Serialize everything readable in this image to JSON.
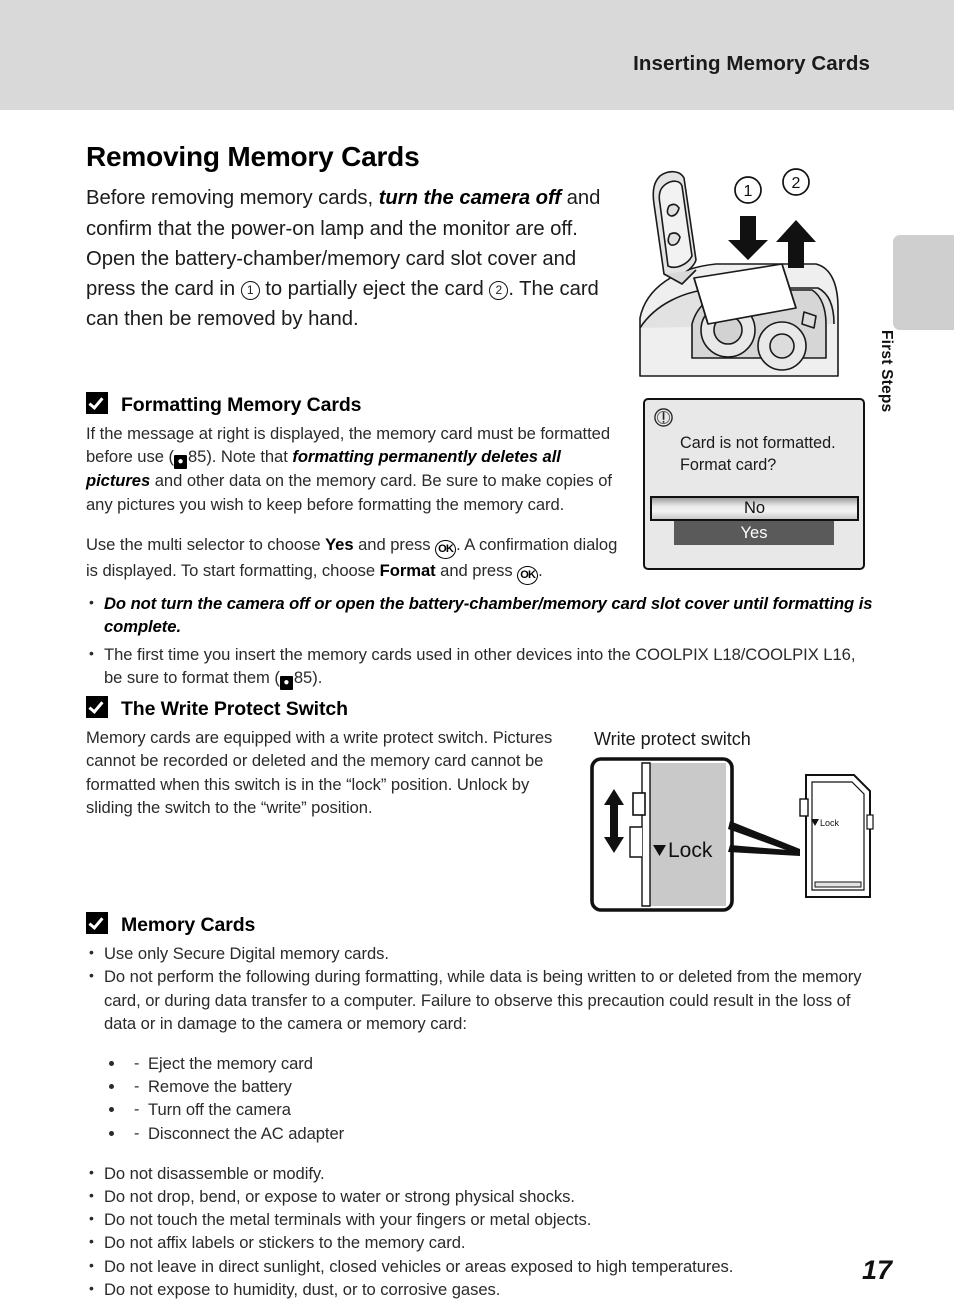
{
  "header": {
    "running_title": "Inserting Memory Cards"
  },
  "side_tab": {
    "label": "First Steps"
  },
  "page": {
    "title": "Removing Memory Cards",
    "number": "17"
  },
  "intro": {
    "part1": "Before removing memory cards, ",
    "bold1": "turn the camera off",
    "part2": " and confirm that the power-on lamp and the monitor are off. Open the battery-chamber/memory card slot cover and press the card in ",
    "circle1": "1",
    "part3": " to partially eject the card ",
    "circle2": "2",
    "part4": ". The card can then be removed by hand."
  },
  "camera_illustration": {
    "name": "camera-card-slot-illustration",
    "callout_1": "1",
    "callout_2": "2"
  },
  "formatting": {
    "heading": "Formatting Memory Cards",
    "p1_a": "If the message at right is displayed, the memory card must be formatted before use (",
    "p1_ref": "85",
    "p1_b": "). Note that ",
    "p1_bi": "formatting permanently deletes all pictures",
    "p1_c": " and other data on the memory card. Be sure to make copies of any pictures you wish to keep before formatting the memory card.",
    "p2_a": "Use the multi selector to choose ",
    "p2_yes": "Yes",
    "p2_b": " and press ",
    "p2_ok1": "OK",
    "p2_c": ". A confirmation dialog is displayed. To start formatting, choose ",
    "p2_format": "Format",
    "p2_d": " and press ",
    "p2_ok2": "OK",
    "p2_e": ".",
    "bullets": [
      {
        "style": "bold-italic",
        "text": "Do not turn the camera off or open the battery-chamber/memory card slot cover until formatting is complete."
      },
      {
        "style": "normal",
        "text_a": "The first time you insert the memory cards used in other devices into the COOLPIX L18/COOLPIX L16, be sure to format them (",
        "ref": "85",
        "text_b": ")."
      }
    ]
  },
  "lcd_dialog": {
    "icon": "warning-icon",
    "message_line1": "Card is not formatted.",
    "message_line2": "Format card?",
    "button_no": "No",
    "button_yes": "Yes"
  },
  "write_protect": {
    "heading": "The Write Protect Switch",
    "body": "Memory cards are equipped with a write protect switch. Pictures cannot be recorded or deleted and the memory card cannot be formatted when this switch is in the “lock” position. Unlock by sliding the switch to the “write” position.",
    "diagram_caption": "Write protect switch",
    "lock_label": "Lock",
    "lock_label_small": "Lock"
  },
  "memory_cards": {
    "heading": "Memory Cards",
    "bullets": [
      "Use only Secure Digital memory cards.",
      "Do not perform the following during formatting, while data is being written to or deleted from the memory card, or during data transfer to a computer. Failure to observe this precaution could result in the loss of data or in damage to the camera or memory card:"
    ],
    "sub_bullets": [
      "Eject the memory card",
      "Remove the battery",
      "Turn off the camera",
      "Disconnect the AC adapter"
    ],
    "bullets2": [
      "Do not disassemble or modify.",
      "Do not drop, bend, or expose to water or strong physical shocks.",
      "Do not touch the metal terminals with your fingers or metal objects.",
      "Do not affix labels or stickers to the memory card.",
      "Do not leave in direct sunlight, closed vehicles or areas exposed to high temperatures.",
      "Do not expose to humidity, dust, or to corrosive gases."
    ]
  },
  "colors": {
    "header_band": "#d9d9d9",
    "side_tab": "#cfcfcf",
    "lcd_background": "#e8e8e8",
    "lcd_selected": "#5a5a5a"
  }
}
